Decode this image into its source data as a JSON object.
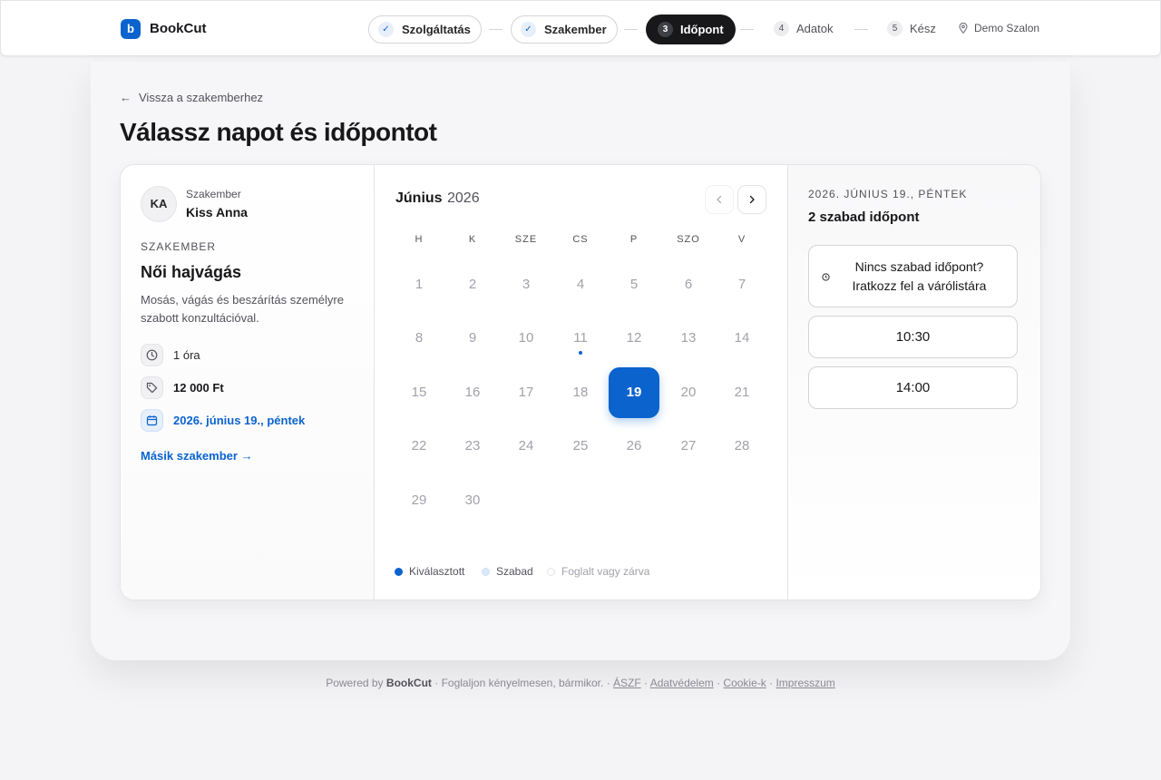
{
  "app": {
    "logo_letter": "b",
    "name": "BookCut"
  },
  "steps": [
    {
      "label": "Szolgáltatás",
      "state": "done"
    },
    {
      "label": "Szakember",
      "state": "done"
    },
    {
      "number": "3",
      "label": "Időpont",
      "state": "active"
    },
    {
      "number": "4",
      "label": "Adatok",
      "state": "todo"
    },
    {
      "number": "5",
      "label": "Kész",
      "state": "todo"
    }
  ],
  "salon": "Demo Szalon",
  "back_link": "Vissza a szakemberhez",
  "page_title": "Válassz napot és időpontot",
  "staff": {
    "initials": "KA",
    "label": "Szakember",
    "name": "Kiss Anna"
  },
  "service": {
    "section_label": "SZAKEMBER",
    "name": "Női hajvágás",
    "description": "Mosás, vágás és beszárítás személyre szabott konzultációval.",
    "duration": "1 óra",
    "price": "12 000 Ft",
    "selected_date": "2026. június 19., péntek"
  },
  "other_staff_link": "Másik szakember →",
  "calendar": {
    "month": "Június",
    "year": "2026",
    "weekdays": [
      "H",
      "K",
      "SZE",
      "CS",
      "P",
      "SZO",
      "V"
    ],
    "weeks": [
      [
        "1",
        "2",
        "3",
        "4",
        "5",
        "6",
        "7"
      ],
      [
        "8",
        "9",
        "10",
        "11",
        "12",
        "13",
        "14"
      ],
      [
        "15",
        "16",
        "17",
        "18",
        "19",
        "20",
        "21"
      ],
      [
        "22",
        "23",
        "24",
        "25",
        "26",
        "27",
        "28"
      ],
      [
        "29",
        "30",
        "",
        "",
        "",
        "",
        ""
      ]
    ],
    "selected_day": "19",
    "marked_day": "11",
    "legend": {
      "selected": "Kiválasztott",
      "free": "Szabad",
      "booked": "Foglalt vagy zárva"
    }
  },
  "slots_panel": {
    "date_heading": "2026. JÚNIUS 19., PÉNTEK",
    "count_text": "2 szabad időpont",
    "waitlist_line1": "Nincs szabad időpont?",
    "waitlist_line2": "Iratkozz fel a várólistára",
    "slots": [
      "10:30",
      "14:00"
    ]
  },
  "footer": {
    "powered": "Powered by",
    "brand": "BookCut",
    "tagline": "· Foglaljon kényelmesen, bármikor. ·",
    "links": [
      "ÁSZF",
      "Adatvédelem",
      "Cookie-k",
      "Impresszum"
    ]
  },
  "colors": {
    "accent": "#0b63ce",
    "dark": "#18181b",
    "muted": "#52525b",
    "free_swatch": "#cfe0f5"
  }
}
